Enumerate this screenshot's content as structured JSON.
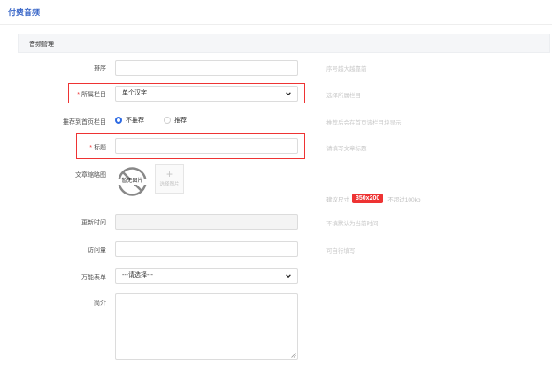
{
  "page_title": "付费音频",
  "section_title": "音频管理",
  "fields": {
    "sort": {
      "label": "排序",
      "hint": "序号越大越靠前"
    },
    "column": {
      "label": "所属栏目",
      "required_mark": "*",
      "value": "单个汉字",
      "hint": "选择所属栏目"
    },
    "recommend": {
      "label": "推荐到首页栏目",
      "options": [
        "不推荐",
        "推荐"
      ],
      "selected": "不推荐",
      "hint": "推荐后会在首页该栏目块显示"
    },
    "title": {
      "label": "标题",
      "required_mark": "*",
      "hint": "请填写文章标题"
    },
    "thumbnail": {
      "label": "文章缩略图",
      "no_image_text": "暂无图片",
      "select_label": "选择图片",
      "size_prefix": "建议尺寸",
      "size_value": "350x200",
      "size_suffix": "不超过100kb"
    },
    "update_time": {
      "label": "更新时间",
      "hint": "不填默认为当前时间"
    },
    "views": {
      "label": "访问量",
      "hint": "可自行填写"
    },
    "form": {
      "label": "万能表单",
      "value": "---请选择---"
    },
    "intro": {
      "label": "简介"
    }
  },
  "colors": {
    "accent": "#2d6ae3",
    "highlight": "#e33333",
    "title": "#3a67c8"
  }
}
